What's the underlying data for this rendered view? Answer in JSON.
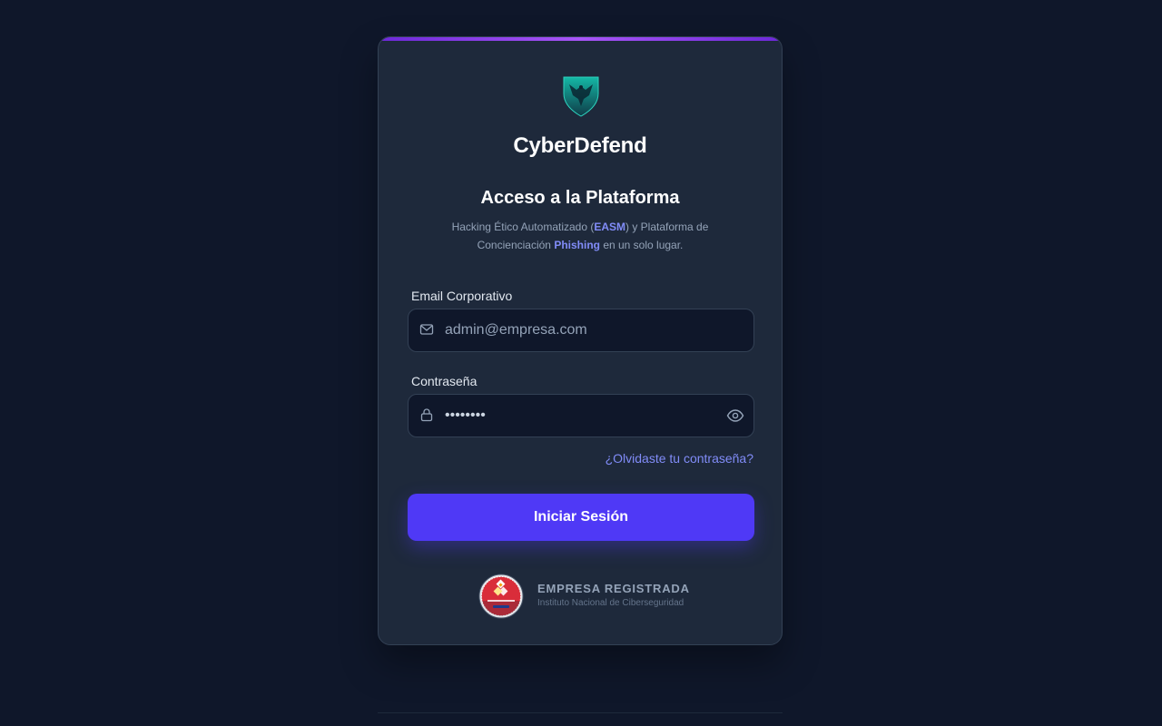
{
  "brand": {
    "name": "CyberDefend",
    "logo_icon": "eagle-shield-icon"
  },
  "login": {
    "heading": "Acceso a la Plataforma",
    "subtitle": {
      "part1": "Hacking Ético Automatizado (",
      "easm": "EASM",
      "part2": ") y Plataforma de Concienciación ",
      "phishing": "Phishing",
      "part3": " en un solo lugar."
    },
    "email": {
      "label": "Email Corporativo",
      "placeholder": "admin@empresa.com",
      "value": "",
      "icon": "mail-icon"
    },
    "password": {
      "label": "Contraseña",
      "value": "••••••••",
      "icon": "lock-icon",
      "toggle_icon": "eye-icon"
    },
    "forgot_link": "¿Olvidaste tu contraseña?",
    "submit_label": "Iniciar Sesión"
  },
  "badge": {
    "title": "EMPRESA REGISTRADA",
    "subtitle": "Instituto Nacional de Ciberseguridad",
    "icon": "incibe-seal-icon"
  },
  "colors": {
    "background": "#0f172a",
    "card": "#1e293b",
    "accent": "#4f39f6",
    "link": "#818cf8",
    "top_bar": "#a855f7"
  }
}
